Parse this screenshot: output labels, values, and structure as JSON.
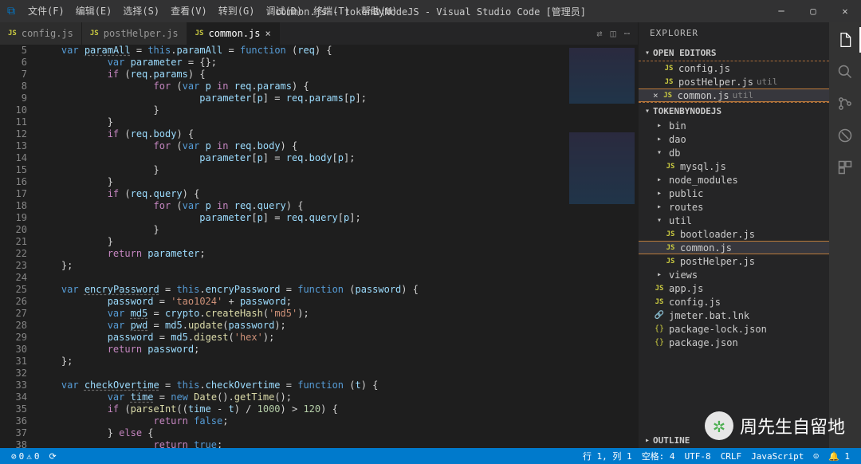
{
  "title_bar": {
    "app_title": "common.js - tokenByNodeJS - Visual Studio Code [管理员]",
    "menu": [
      "文件(F)",
      "编辑(E)",
      "选择(S)",
      "查看(V)",
      "转到(G)",
      "调试(D)",
      "终端(T)",
      "帮助(H)"
    ]
  },
  "tabs": [
    {
      "label": "config.js",
      "active": false,
      "closeable": false
    },
    {
      "label": "postHelper.js",
      "active": false,
      "closeable": false
    },
    {
      "label": "common.js",
      "active": true,
      "closeable": true
    }
  ],
  "code_lines": [
    {
      "n": 5,
      "html": "<span class='kw'>var</span> <span class='id und'>paramAll</span> <span class='op'>=</span> <span class='thiss'>this</span>.<span class='id'>paramAll</span> <span class='op'>=</span> <span class='kw'>function</span> (<span class='id'>req</span>) {"
    },
    {
      "n": 6,
      "html": "    <span class='kw'>var</span> <span class='id'>parameter</span> <span class='op'>=</span> {};"
    },
    {
      "n": 7,
      "html": "    <span class='kw2'>if</span> (<span class='id'>req</span>.<span class='id'>params</span>) {"
    },
    {
      "n": 8,
      "html": "        <span class='kw2'>for</span> (<span class='kw'>var</span> <span class='id'>p</span> <span class='kw2'>in</span> <span class='id'>req</span>.<span class='id'>params</span>) {"
    },
    {
      "n": 9,
      "html": "            <span class='id'>parameter</span>[<span class='id'>p</span>] <span class='op'>=</span> <span class='id'>req</span>.<span class='id'>params</span>[<span class='id'>p</span>];"
    },
    {
      "n": 10,
      "html": "        }"
    },
    {
      "n": 11,
      "html": "    }"
    },
    {
      "n": 12,
      "html": "    <span class='kw2'>if</span> (<span class='id'>req</span>.<span class='id'>body</span>) {"
    },
    {
      "n": 13,
      "html": "        <span class='kw2'>for</span> (<span class='kw'>var</span> <span class='id'>p</span> <span class='kw2'>in</span> <span class='id'>req</span>.<span class='id'>body</span>) {"
    },
    {
      "n": 14,
      "html": "            <span class='id'>parameter</span>[<span class='id'>p</span>] <span class='op'>=</span> <span class='id'>req</span>.<span class='id'>body</span>[<span class='id'>p</span>];"
    },
    {
      "n": 15,
      "html": "        }"
    },
    {
      "n": 16,
      "html": "    }"
    },
    {
      "n": 17,
      "html": "    <span class='kw2'>if</span> (<span class='id'>req</span>.<span class='id'>query</span>) {"
    },
    {
      "n": 18,
      "html": "        <span class='kw2'>for</span> (<span class='kw'>var</span> <span class='id'>p</span> <span class='kw2'>in</span> <span class='id'>req</span>.<span class='id'>query</span>) {"
    },
    {
      "n": 19,
      "html": "            <span class='id'>parameter</span>[<span class='id'>p</span>] <span class='op'>=</span> <span class='id'>req</span>.<span class='id'>query</span>[<span class='id'>p</span>];"
    },
    {
      "n": 20,
      "html": "        }"
    },
    {
      "n": 21,
      "html": "    }"
    },
    {
      "n": 22,
      "html": "    <span class='kw2'>return</span> <span class='id'>parameter</span>;"
    },
    {
      "n": 23,
      "html": "};"
    },
    {
      "n": 24,
      "html": ""
    },
    {
      "n": 25,
      "html": "<span class='kw'>var</span> <span class='id und'>encryPassword</span> <span class='op'>=</span> <span class='thiss'>this</span>.<span class='id'>encryPassword</span> <span class='op'>=</span> <span class='kw'>function</span> (<span class='id'>password</span>) {"
    },
    {
      "n": 26,
      "html": "    <span class='id'>password</span> <span class='op'>=</span> <span class='str'>'tao1024'</span> <span class='op'>+</span> <span class='id'>password</span>;"
    },
    {
      "n": 27,
      "html": "    <span class='kw'>var</span> <span class='id und'>md5</span> <span class='op'>=</span> <span class='id'>crypto</span>.<span class='fn'>createHash</span>(<span class='str'>'md5'</span>);"
    },
    {
      "n": 28,
      "html": "    <span class='kw'>var</span> <span class='id und'>pwd</span> <span class='op'>=</span> <span class='id'>md5</span>.<span class='fn'>update</span>(<span class='id'>password</span>);"
    },
    {
      "n": 29,
      "html": "    <span class='id'>password</span> <span class='op'>=</span> <span class='id'>md5</span>.<span class='fn'>digest</span>(<span class='str'>'hex'</span>);"
    },
    {
      "n": 30,
      "html": "    <span class='kw2'>return</span> <span class='id'>password</span>;"
    },
    {
      "n": 31,
      "html": "};"
    },
    {
      "n": 32,
      "html": ""
    },
    {
      "n": 33,
      "html": "<span class='kw'>var</span> <span class='id und'>checkOvertime</span> <span class='op'>=</span> <span class='thiss'>this</span>.<span class='id'>checkOvertime</span> <span class='op'>=</span> <span class='kw'>function</span> (<span class='id'>t</span>) {"
    },
    {
      "n": 34,
      "html": "    <span class='kw'>var</span> <span class='id und'>time</span> <span class='op'>=</span> <span class='kw'>new</span> <span class='fn'>Date</span>().<span class='fn'>getTime</span>();"
    },
    {
      "n": 35,
      "html": "    <span class='kw2'>if</span> (<span class='fn'>parseInt</span>((<span class='id'>time</span> <span class='op'>-</span> <span class='id'>t</span>) <span class='op'>/</span> <span class='num'>1000</span>) <span class='op'>&gt;</span> <span class='num'>120</span>) {"
    },
    {
      "n": 36,
      "html": "        <span class='kw2'>return</span> <span class='kw'>false</span>;"
    },
    {
      "n": 37,
      "html": "    } <span class='kw2'>else</span> {"
    },
    {
      "n": 38,
      "html": "        <span class='kw2'>return</span> <span class='kw'>true</span>;"
    }
  ],
  "explorer": {
    "title": "EXPLORER",
    "open_editors": {
      "label": "OPEN EDITORS",
      "items": [
        {
          "name": "config.js",
          "icon": "JS"
        },
        {
          "name": "postHelper.js",
          "icon": "JS",
          "dim": "util"
        },
        {
          "name": "common.js",
          "icon": "JS",
          "dim": "util",
          "active": true,
          "close": true
        }
      ]
    },
    "project": {
      "label": "TOKENBYNODEJS",
      "tree": [
        {
          "indent": 1,
          "type": "folder",
          "name": "bin"
        },
        {
          "indent": 1,
          "type": "folder",
          "name": "dao"
        },
        {
          "indent": 1,
          "type": "folder-open",
          "name": "db"
        },
        {
          "indent": 2,
          "type": "js",
          "name": "mysql.js"
        },
        {
          "indent": 1,
          "type": "folder",
          "name": "node_modules"
        },
        {
          "indent": 1,
          "type": "folder",
          "name": "public"
        },
        {
          "indent": 1,
          "type": "folder",
          "name": "routes"
        },
        {
          "indent": 1,
          "type": "folder-open",
          "name": "util"
        },
        {
          "indent": 2,
          "type": "js",
          "name": "bootloader.js"
        },
        {
          "indent": 2,
          "type": "js",
          "name": "common.js",
          "active": true
        },
        {
          "indent": 2,
          "type": "js",
          "name": "postHelper.js"
        },
        {
          "indent": 1,
          "type": "folder",
          "name": "views"
        },
        {
          "indent": 1,
          "type": "js",
          "name": "app.js"
        },
        {
          "indent": 1,
          "type": "js",
          "name": "config.js"
        },
        {
          "indent": 1,
          "type": "file",
          "name": "jmeter.bat.lnk"
        },
        {
          "indent": 1,
          "type": "json",
          "name": "package-lock.json"
        },
        {
          "indent": 1,
          "type": "json",
          "name": "package.json"
        }
      ]
    },
    "outline": "OUTLINE"
  },
  "status": {
    "left": {
      "errors": "0",
      "warnings": "0",
      "sync": "⟳"
    },
    "right": {
      "pos": "行 1, 列 1",
      "spaces": "空格: 4",
      "encoding": "UTF-8",
      "eol": "CRLF",
      "lang": "JavaScript",
      "smile": "☺",
      "bell": "🔔 1"
    }
  },
  "watermark": "周先生自留地"
}
